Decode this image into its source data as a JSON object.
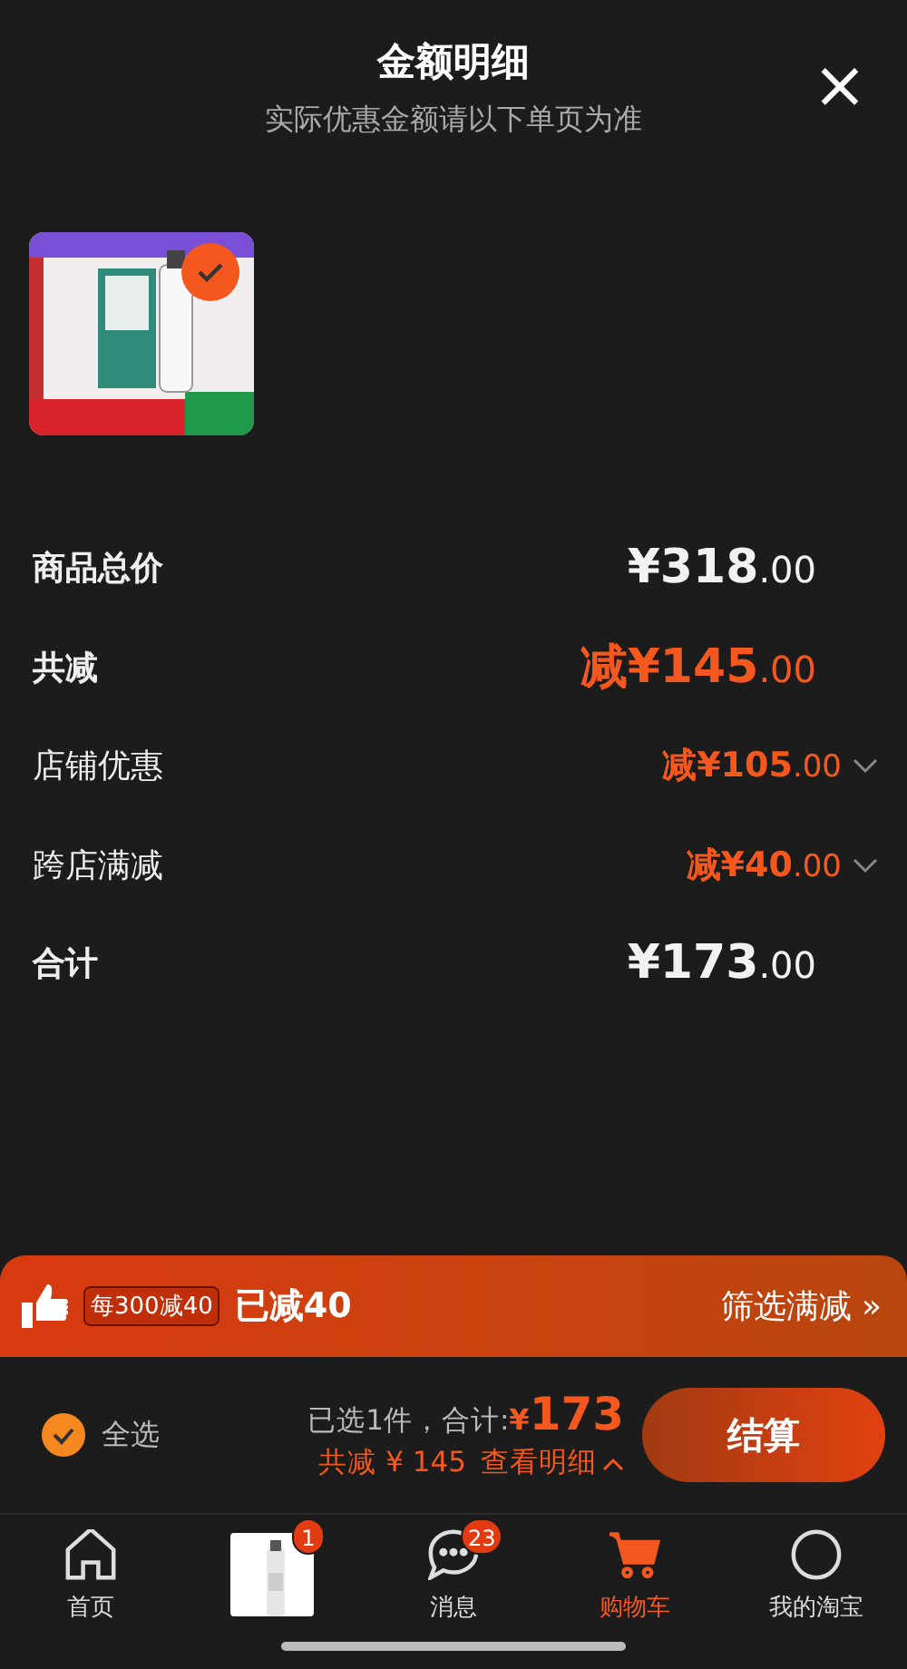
{
  "header": {
    "title": "金额明细",
    "subtitle": "实际优惠金额请以下单页为准",
    "close": "×"
  },
  "product": {
    "kind": "picture",
    "selected": true
  },
  "rows": [
    {
      "label": "商品总价",
      "value": "¥318",
      "cents": ".00",
      "kind": "plain",
      "emphasis": true,
      "large": true,
      "expandable": false
    },
    {
      "label": "共减",
      "value": "减¥145",
      "cents": ".00",
      "kind": "discount",
      "emphasis": true,
      "large": true,
      "expandable": false
    },
    {
      "label": "店铺优惠",
      "value": "减¥105",
      "cents": ".00",
      "kind": "discount",
      "emphasis": false,
      "large": false,
      "expandable": true
    },
    {
      "label": "跨店满减",
      "value": "减¥40",
      "cents": ".00",
      "kind": "discount",
      "emphasis": false,
      "large": false,
      "expandable": true
    },
    {
      "label": "合计",
      "value": "¥173",
      "cents": ".00",
      "kind": "plain",
      "emphasis": true,
      "large": true,
      "expandable": false
    }
  ],
  "promo": {
    "tag": "每300减40",
    "text": "已减40",
    "link": "筛选满减",
    "link_arrow": "»"
  },
  "checkout": {
    "select_all": {
      "label": "全选",
      "checked": true
    },
    "summary": "已选1件，合计:",
    "currency": "¥",
    "total": "173",
    "discount": "共减 ¥ 145",
    "details": "查看明细",
    "button": "结算"
  },
  "nav": [
    {
      "kind": "home",
      "label": "首页",
      "selected": false
    },
    {
      "kind": "picture",
      "badge": "1",
      "selected": false
    },
    {
      "kind": "message",
      "label": "消息",
      "badge": "23",
      "selected": false
    },
    {
      "kind": "cart",
      "label": "购物车",
      "selected": true
    },
    {
      "kind": "profile",
      "label": "我的淘宝",
      "selected": false
    }
  ]
}
